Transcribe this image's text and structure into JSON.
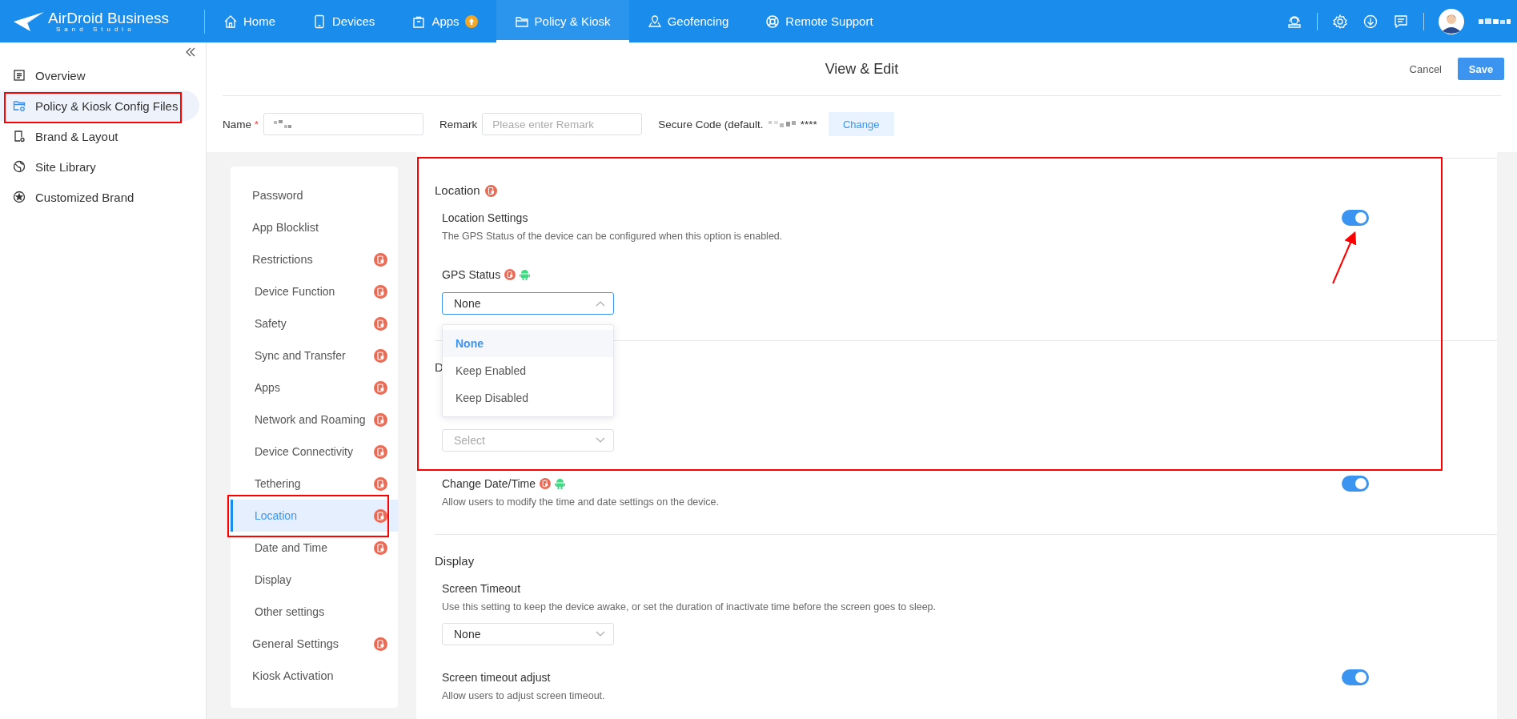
{
  "brand": {
    "title": "AirDroid Business",
    "subtitle": "Sand Studio"
  },
  "nav": [
    {
      "label": "Home",
      "selected": false,
      "update_badge": false
    },
    {
      "label": "Devices",
      "selected": false,
      "update_badge": false
    },
    {
      "label": "Apps",
      "selected": false,
      "update_badge": true
    },
    {
      "label": "Policy & Kiosk",
      "selected": true,
      "update_badge": false
    },
    {
      "label": "Geofencing",
      "selected": false,
      "update_badge": false
    },
    {
      "label": "Remote Support",
      "selected": false,
      "update_badge": false
    }
  ],
  "sidebar": {
    "items": [
      {
        "label": "Overview",
        "selected": false
      },
      {
        "label": "Policy & Kiosk Config Files",
        "selected": true
      },
      {
        "label": "Brand & Layout",
        "selected": false
      },
      {
        "label": "Site Library",
        "selected": false
      },
      {
        "label": "Customized Brand",
        "selected": false
      }
    ]
  },
  "header": {
    "title": "View & Edit",
    "cancel": "Cancel",
    "save": "Save"
  },
  "form": {
    "name_label": "Name",
    "required_mark": "*",
    "remark_label": "Remark",
    "remark_placeholder": "Please enter Remark",
    "secure_label": "Secure Code (default.",
    "secure_suffix": "****",
    "change": "Change"
  },
  "settings_nav": [
    {
      "label": "Password",
      "locked": false,
      "selected": false
    },
    {
      "label": "App Blocklist",
      "locked": false,
      "selected": false
    },
    {
      "label": "Restrictions",
      "locked": true,
      "selected": false,
      "children": [
        {
          "label": "Device Function",
          "locked": true,
          "selected": false
        },
        {
          "label": "Safety",
          "locked": true,
          "selected": false
        },
        {
          "label": "Sync and Transfer",
          "locked": true,
          "selected": false
        },
        {
          "label": "Apps",
          "locked": true,
          "selected": false
        },
        {
          "label": "Network and Roaming",
          "locked": true,
          "selected": false
        },
        {
          "label": "Device Connectivity",
          "locked": true,
          "selected": false
        },
        {
          "label": "Tethering",
          "locked": true,
          "selected": false
        },
        {
          "label": "Location",
          "locked": true,
          "selected": true
        },
        {
          "label": "Date and Time",
          "locked": true,
          "selected": false
        },
        {
          "label": "Display",
          "locked": false,
          "selected": false
        },
        {
          "label": "Other settings",
          "locked": false,
          "selected": false
        }
      ]
    },
    {
      "label": "General Settings",
      "locked": true,
      "selected": false
    },
    {
      "label": "Kiosk Activation",
      "locked": false,
      "selected": false
    }
  ],
  "sections": [
    {
      "title": "Location",
      "locked": true,
      "items": [
        {
          "kind": "toggle",
          "label": "Location Settings",
          "description": "The GPS Status of the device can be configured when this option is enabled.",
          "locked": false,
          "android": false,
          "on": true
        },
        {
          "kind": "select",
          "label": "GPS Status",
          "locked": true,
          "android": true,
          "value": "None",
          "open": true,
          "options": [
            {
              "label": "None",
              "selected": true
            },
            {
              "label": "Keep Enabled",
              "selected": false
            },
            {
              "label": "Keep Disabled",
              "selected": false
            }
          ]
        }
      ]
    },
    {
      "title": "D",
      "locked": false,
      "items": [
        {
          "kind": "select",
          "placeholder": "Select",
          "open": false
        },
        {
          "kind": "toggle",
          "label": "Change Date/Time",
          "description": "Allow users to modify the time and date settings on the device.",
          "locked": true,
          "android": true,
          "on": true
        }
      ]
    },
    {
      "title": "Display",
      "locked": false,
      "items": [
        {
          "kind": "select",
          "label": "Screen Timeout",
          "description": "Use this setting to keep the device awake, or set the duration of inactivate time before the screen goes to sleep.",
          "value": "None",
          "open": false,
          "locked": false,
          "android": false
        },
        {
          "kind": "toggle",
          "label": "Screen timeout adjust",
          "description": "Allow users to adjust screen timeout.",
          "locked": false,
          "android": false,
          "on": true
        }
      ]
    }
  ]
}
